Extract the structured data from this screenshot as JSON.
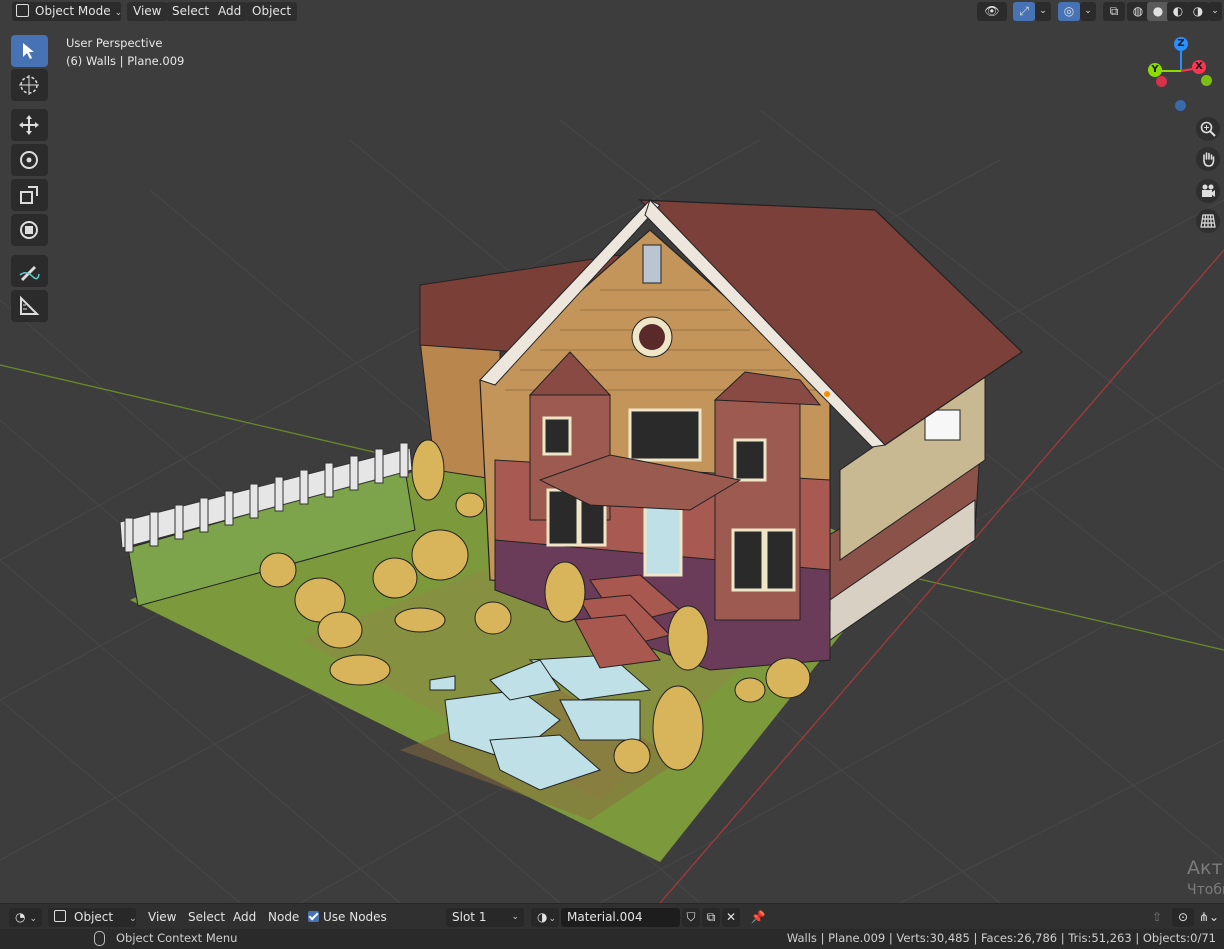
{
  "header": {
    "mode": "Object Mode",
    "menu": [
      "View",
      "Select",
      "Add",
      "Object"
    ]
  },
  "viewport": {
    "view_name": "User Perspective",
    "active": "(6) Walls | Plane.009"
  },
  "gizmo": {
    "z": "Z",
    "y": "Y",
    "x": "X"
  },
  "watermark": {
    "line1": "Акти",
    "line2": "Чтобы"
  },
  "node_header": {
    "editor_type": "Object",
    "menu": [
      "View",
      "Select",
      "Add",
      "Node"
    ],
    "use_nodes_label": "Use Nodes",
    "slot": "Slot 1",
    "material": "Material.004"
  },
  "status": {
    "left": "Object Context Menu",
    "right": "Walls | Plane.009 | Verts:30,485 | Faces:26,786 | Tris:51,263 | Objects:0/71"
  },
  "colors": {
    "accent": "#4772b3",
    "axis_x": "#ff3352",
    "axis_y": "#8bdc00",
    "axis_z": "#2890ff"
  }
}
